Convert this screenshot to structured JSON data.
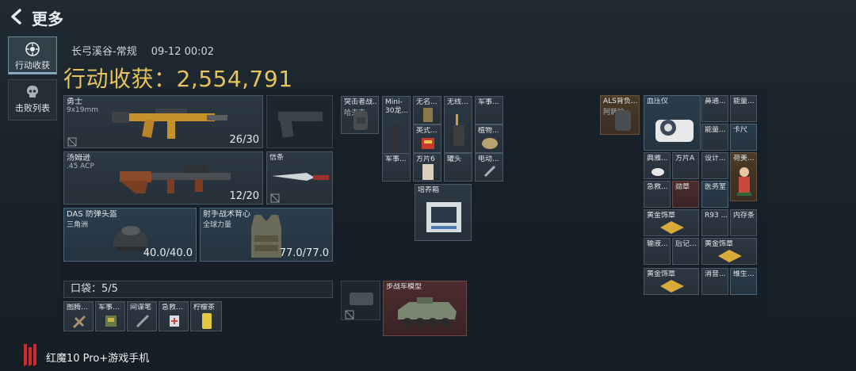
{
  "header": {
    "title": "更多"
  },
  "tabs": [
    {
      "label": "行动收获",
      "icon": "target-icon"
    },
    {
      "label": "击败列表",
      "icon": "skull-icon"
    }
  ],
  "summary": {
    "map": "长弓溪谷-常规",
    "time": "09-12 00:02",
    "label": "行动收获：2,554,791"
  },
  "loadout": {
    "primary": {
      "name": "勇士",
      "ammo": "9x19mm",
      "count": "26/30"
    },
    "secondary": {
      "name": "汤姆逊",
      "ammo": ".45 ACP",
      "count": "12/20"
    },
    "knife": {
      "name": "信条"
    },
    "helmet": {
      "name": "DAS 防弹头盔",
      "sub": "三角洲",
      "durability": "40.0/40.0"
    },
    "armor": {
      "name": "射手战术背心",
      "sub": "全球力量",
      "durability": "77.0/77.0"
    }
  },
  "pocket": {
    "label": "口袋：5/5",
    "items": [
      "图腾...",
      "军事...",
      "间谍笔",
      "急救...",
      "柠檬茶"
    ]
  },
  "backpack_items": [
    {
      "name": "突击者战...",
      "sub": "哈夫克"
    },
    {
      "name": "Mini-30龙..."
    },
    {
      "name": "无名..."
    },
    {
      "name": "无线..."
    },
    {
      "name": "军事..."
    },
    {
      "name": "英式..."
    },
    {
      "name": "植物..."
    },
    {
      "name": "军事..."
    },
    {
      "name": "方片6"
    },
    {
      "name": "罐头"
    },
    {
      "name": "电动..."
    },
    {
      "name": "培养箱"
    },
    {
      "name": "步战车模型"
    }
  ],
  "safebox_items": [
    {
      "name": "ALS背负...",
      "sub": "阿萨拉"
    },
    {
      "name": "血压仪"
    },
    {
      "name": "鼻通..."
    },
    {
      "name": "能量..."
    },
    {
      "name": "能量..."
    },
    {
      "name": "卡尺"
    },
    {
      "name": "典雅..."
    },
    {
      "name": "方片A"
    },
    {
      "name": "设计..."
    },
    {
      "name": "荷美..."
    },
    {
      "name": "急救..."
    },
    {
      "name": "勋章"
    },
    {
      "name": "医务室"
    },
    {
      "name": "黄金饰章"
    },
    {
      "name": "R93 ..."
    },
    {
      "name": "内存条"
    },
    {
      "name": "输液..."
    },
    {
      "name": "后记..."
    },
    {
      "name": "黄金饰章"
    },
    {
      "name": "黄金饰章"
    },
    {
      "name": "消音..."
    },
    {
      "name": "维生..."
    }
  ],
  "brand": {
    "text": "红魔10 Pro+游戏手机"
  },
  "colors": {
    "accent_gold": "#e8c35a",
    "panel_border": "#4a5864"
  }
}
